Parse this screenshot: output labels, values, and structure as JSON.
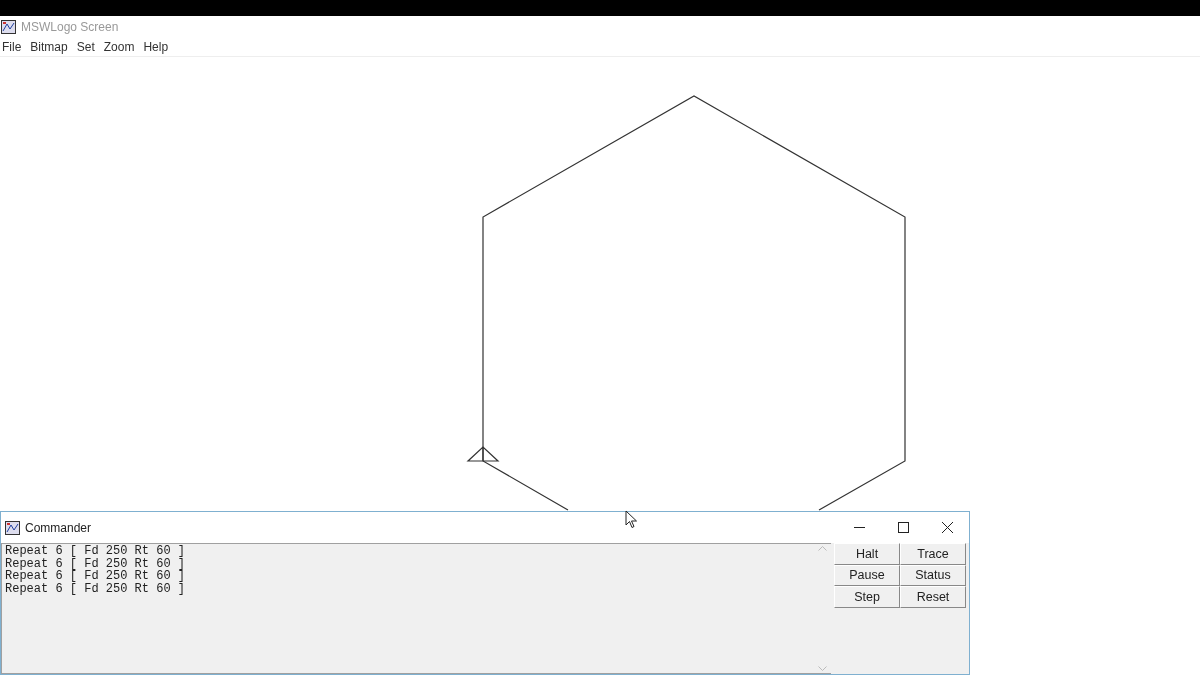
{
  "window": {
    "title": "MSWLogo Screen"
  },
  "menu": [
    "File",
    "Bitmap",
    "Set",
    "Zoom",
    "Help"
  ],
  "commander": {
    "title": "Commander",
    "history": [
      "Repeat 6 [ Fd 250 Rt 60 ]",
      "Repeat 6 [ Fd 250 Rt 60 ]",
      "Repeat 6 [ Fd 250 Rt 60 ]",
      "Repeat 6 [ Fd 250 Rt 60 ]"
    ],
    "buttons": [
      "Halt",
      "Trace",
      "Pause",
      "Status",
      "Step",
      "Reset"
    ]
  }
}
